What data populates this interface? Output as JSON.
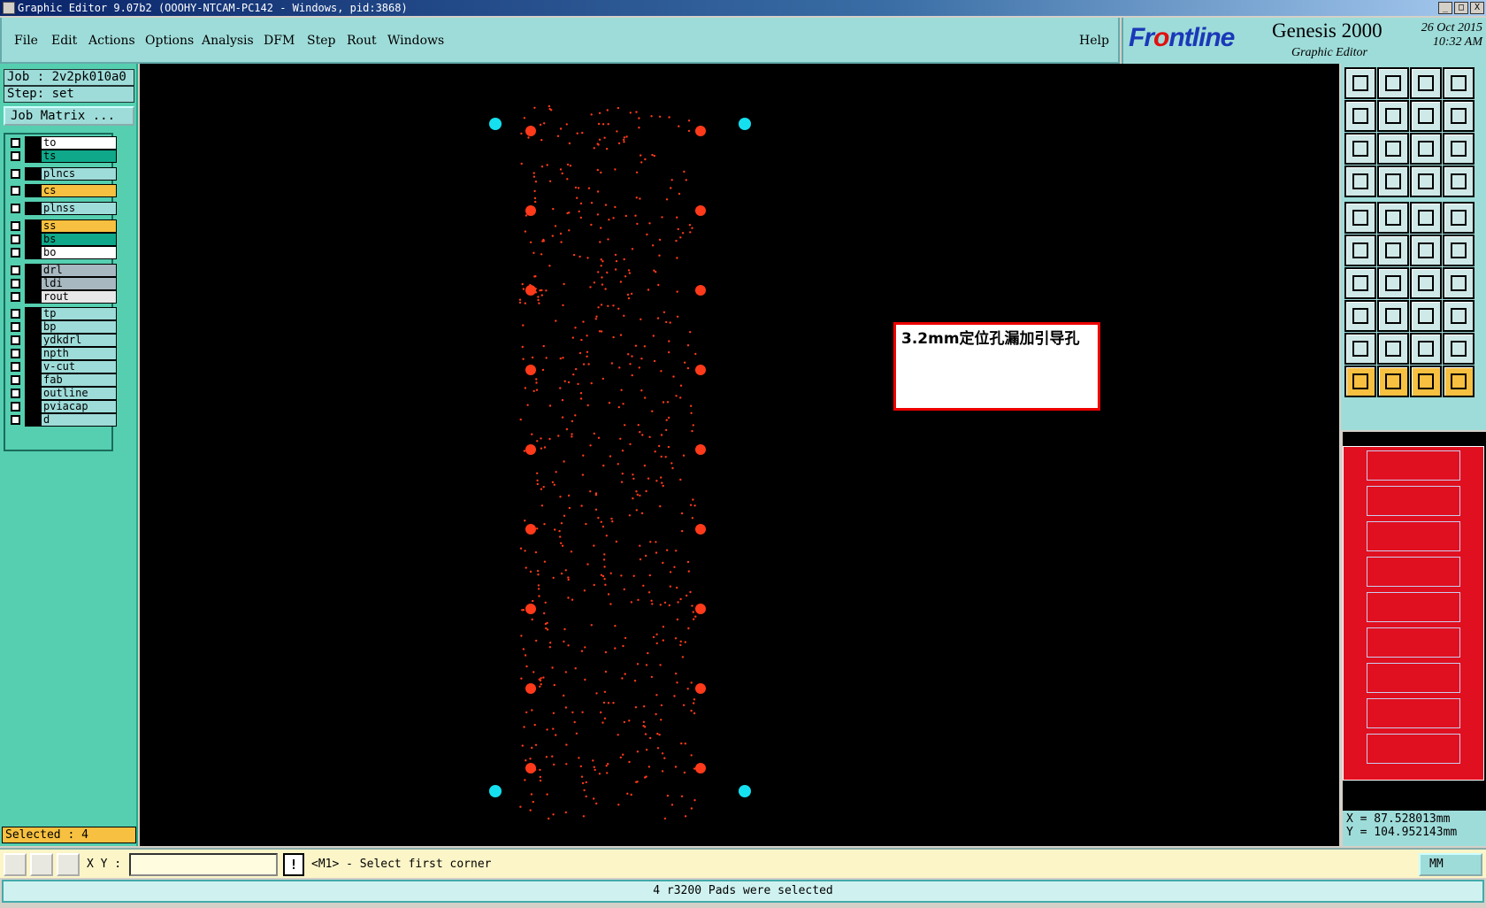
{
  "window": {
    "title": "Graphic Editor 9.07b2 (OOOHY-NTCAM-PC142 - Windows, pid:3868)",
    "controls": [
      "_",
      "□",
      "X"
    ]
  },
  "menu": {
    "items": [
      "File",
      "Edit",
      "Actions",
      "Options",
      "Analysis",
      "DFM",
      "Step",
      "Rout",
      "Windows"
    ],
    "help": "Help"
  },
  "brand": {
    "logo_pre": "Fr",
    "logo_dot": "o",
    "logo_post": "ntline",
    "product": "Genesis 2000",
    "subtitle": "Graphic Editor",
    "date": "26 Oct 2015",
    "time": "10:32 AM"
  },
  "job": {
    "job": "Job : 2v2pk010a0",
    "step": "Step: set",
    "matrix_button": "Job Matrix ..."
  },
  "layers": [
    {
      "name": "to",
      "color": "#ffffff"
    },
    {
      "name": "ts",
      "color": "#0fa88a"
    },
    {
      "name": "plncs",
      "color": "#9edcd9"
    },
    {
      "name": "cs",
      "color": "#f7c040"
    },
    {
      "name": "plnss",
      "color": "#9edcd9"
    },
    {
      "name": "ss",
      "color": "#f7c040"
    },
    {
      "name": "bs",
      "color": "#0fa88a"
    },
    {
      "name": "bo",
      "color": "#ffffff"
    },
    {
      "name": "drl",
      "color": "#a8b8c0"
    },
    {
      "name": "ldi",
      "color": "#a8b8c0"
    },
    {
      "name": "rout",
      "color": "#e8e8e8"
    },
    {
      "name": "tp",
      "color": "#9edcd9"
    },
    {
      "name": "bp",
      "color": "#9edcd9"
    },
    {
      "name": "ydkdrl",
      "color": "#9edcd9"
    },
    {
      "name": "npth",
      "color": "#9edcd9"
    },
    {
      "name": "v-cut",
      "color": "#9edcd9"
    },
    {
      "name": "fab",
      "color": "#9edcd9"
    },
    {
      "name": "outline",
      "color": "#9edcd9"
    },
    {
      "name": "pviacap",
      "color": "#9edcd9"
    },
    {
      "name": "d",
      "color": "#9edcd9"
    }
  ],
  "selected": "Selected : 4",
  "annotation": "3.2mm定位孔漏加引导孔",
  "canvas_colors": {
    "board_pad": "#ff3a1a",
    "tooling_hole": "#15e0f0"
  },
  "coords": {
    "x": "X = 87.528013mm",
    "y": "Y = 104.952143mm"
  },
  "command": {
    "xy_label": "X Y :",
    "xy_value": "",
    "bang": "!",
    "prompt": "<M1> - Select first corner",
    "unit": "MM"
  },
  "status": "4 r3200 Pads were selected"
}
